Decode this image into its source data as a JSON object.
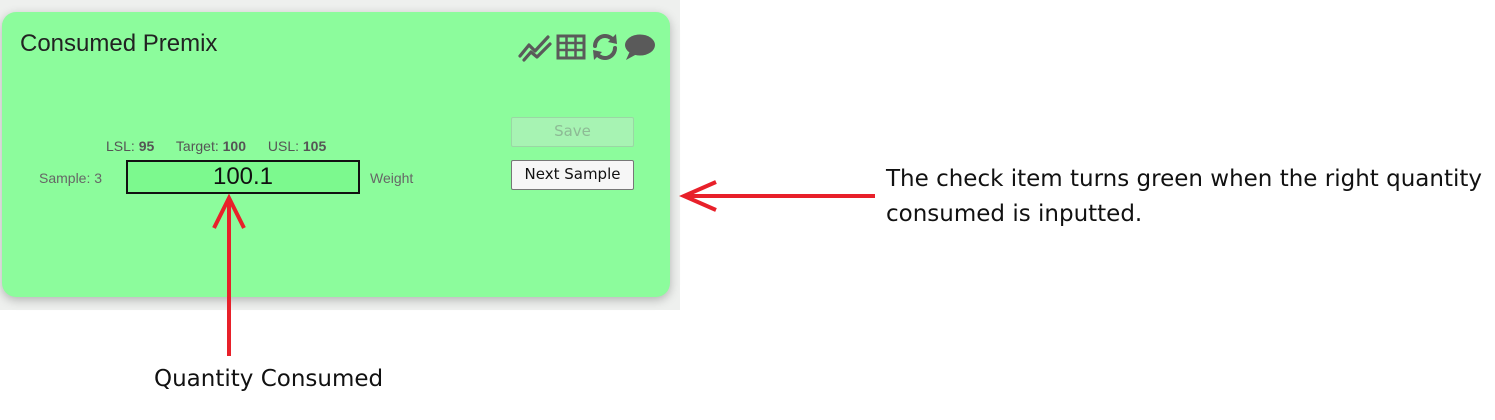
{
  "card": {
    "title": "Consumed Premix",
    "background": "#8cfc9c",
    "icons": [
      "trend-chart-icon",
      "table-grid-icon",
      "refresh-icon",
      "comment-icon"
    ]
  },
  "limits": {
    "lsl_label": "LSL:",
    "lsl_value": "95",
    "target_label": "Target:",
    "target_value": "100",
    "usl_label": "USL:",
    "usl_value": "105"
  },
  "entry": {
    "sample_label": "Sample: 3",
    "value": "100.1",
    "unit_label": "Weight",
    "input_background": "#7cf98e"
  },
  "buttons": {
    "save_label": "Save",
    "next_label": "Next Sample"
  },
  "annotations": {
    "right_text": "The check item turns green when the right quantity consumed is inputted.",
    "bottom_text": "Quantity Consumed",
    "arrow_color": "#e8202a"
  }
}
